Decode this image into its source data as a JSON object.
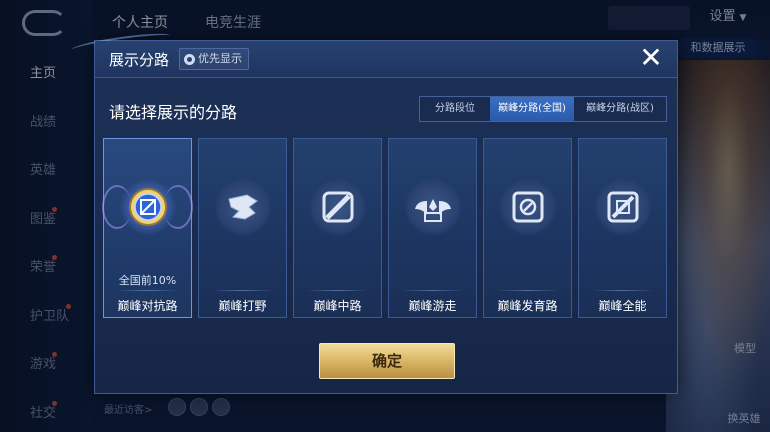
{
  "nav": {
    "items": [
      {
        "label": "主页",
        "active": true,
        "badge": false
      },
      {
        "label": "战绩",
        "active": false,
        "badge": false
      },
      {
        "label": "英雄",
        "active": false,
        "badge": false
      },
      {
        "label": "图鉴",
        "active": false,
        "badge": true
      },
      {
        "label": "荣誉",
        "active": false,
        "badge": true
      },
      {
        "label": "护卫队",
        "active": false,
        "badge": true
      },
      {
        "label": "游戏",
        "active": false,
        "badge": true
      },
      {
        "label": "社交",
        "active": false,
        "badge": true
      }
    ]
  },
  "top_tabs": [
    "个人主页",
    "电竞生涯"
  ],
  "top_right": {
    "settings_label": "设置",
    "pill_label": "和数据展示"
  },
  "bottom": {
    "recent_visitors": "最近访客>",
    "model_label": "模型",
    "switch_hero_label": "换英雄"
  },
  "modal": {
    "title": "展示分路",
    "priority_label": "优先显示",
    "subtitle": "请选择展示的分路",
    "segments": [
      "分路段位",
      "巅峰分路(全国)",
      "巅峰分路(战区)"
    ],
    "active_segment": 1,
    "cards": [
      {
        "label": "巅峰对抗路",
        "rank": "全国前10%",
        "selected": true,
        "icon": "sword-shield-icon"
      },
      {
        "label": "巅峰打野",
        "rank": "",
        "selected": false,
        "icon": "dragon-icon"
      },
      {
        "label": "巅峰中路",
        "rank": "",
        "selected": false,
        "icon": "staff-icon"
      },
      {
        "label": "巅峰游走",
        "rank": "",
        "selected": false,
        "icon": "wings-icon"
      },
      {
        "label": "巅峰发育路",
        "rank": "",
        "selected": false,
        "icon": "crosshair-icon"
      },
      {
        "label": "巅峰全能",
        "rank": "",
        "selected": false,
        "icon": "allround-icon"
      }
    ],
    "confirm_label": "确定"
  },
  "colors": {
    "accent": "#3a6fc4",
    "gold": "#d9b565",
    "panel": "#1d3157"
  }
}
